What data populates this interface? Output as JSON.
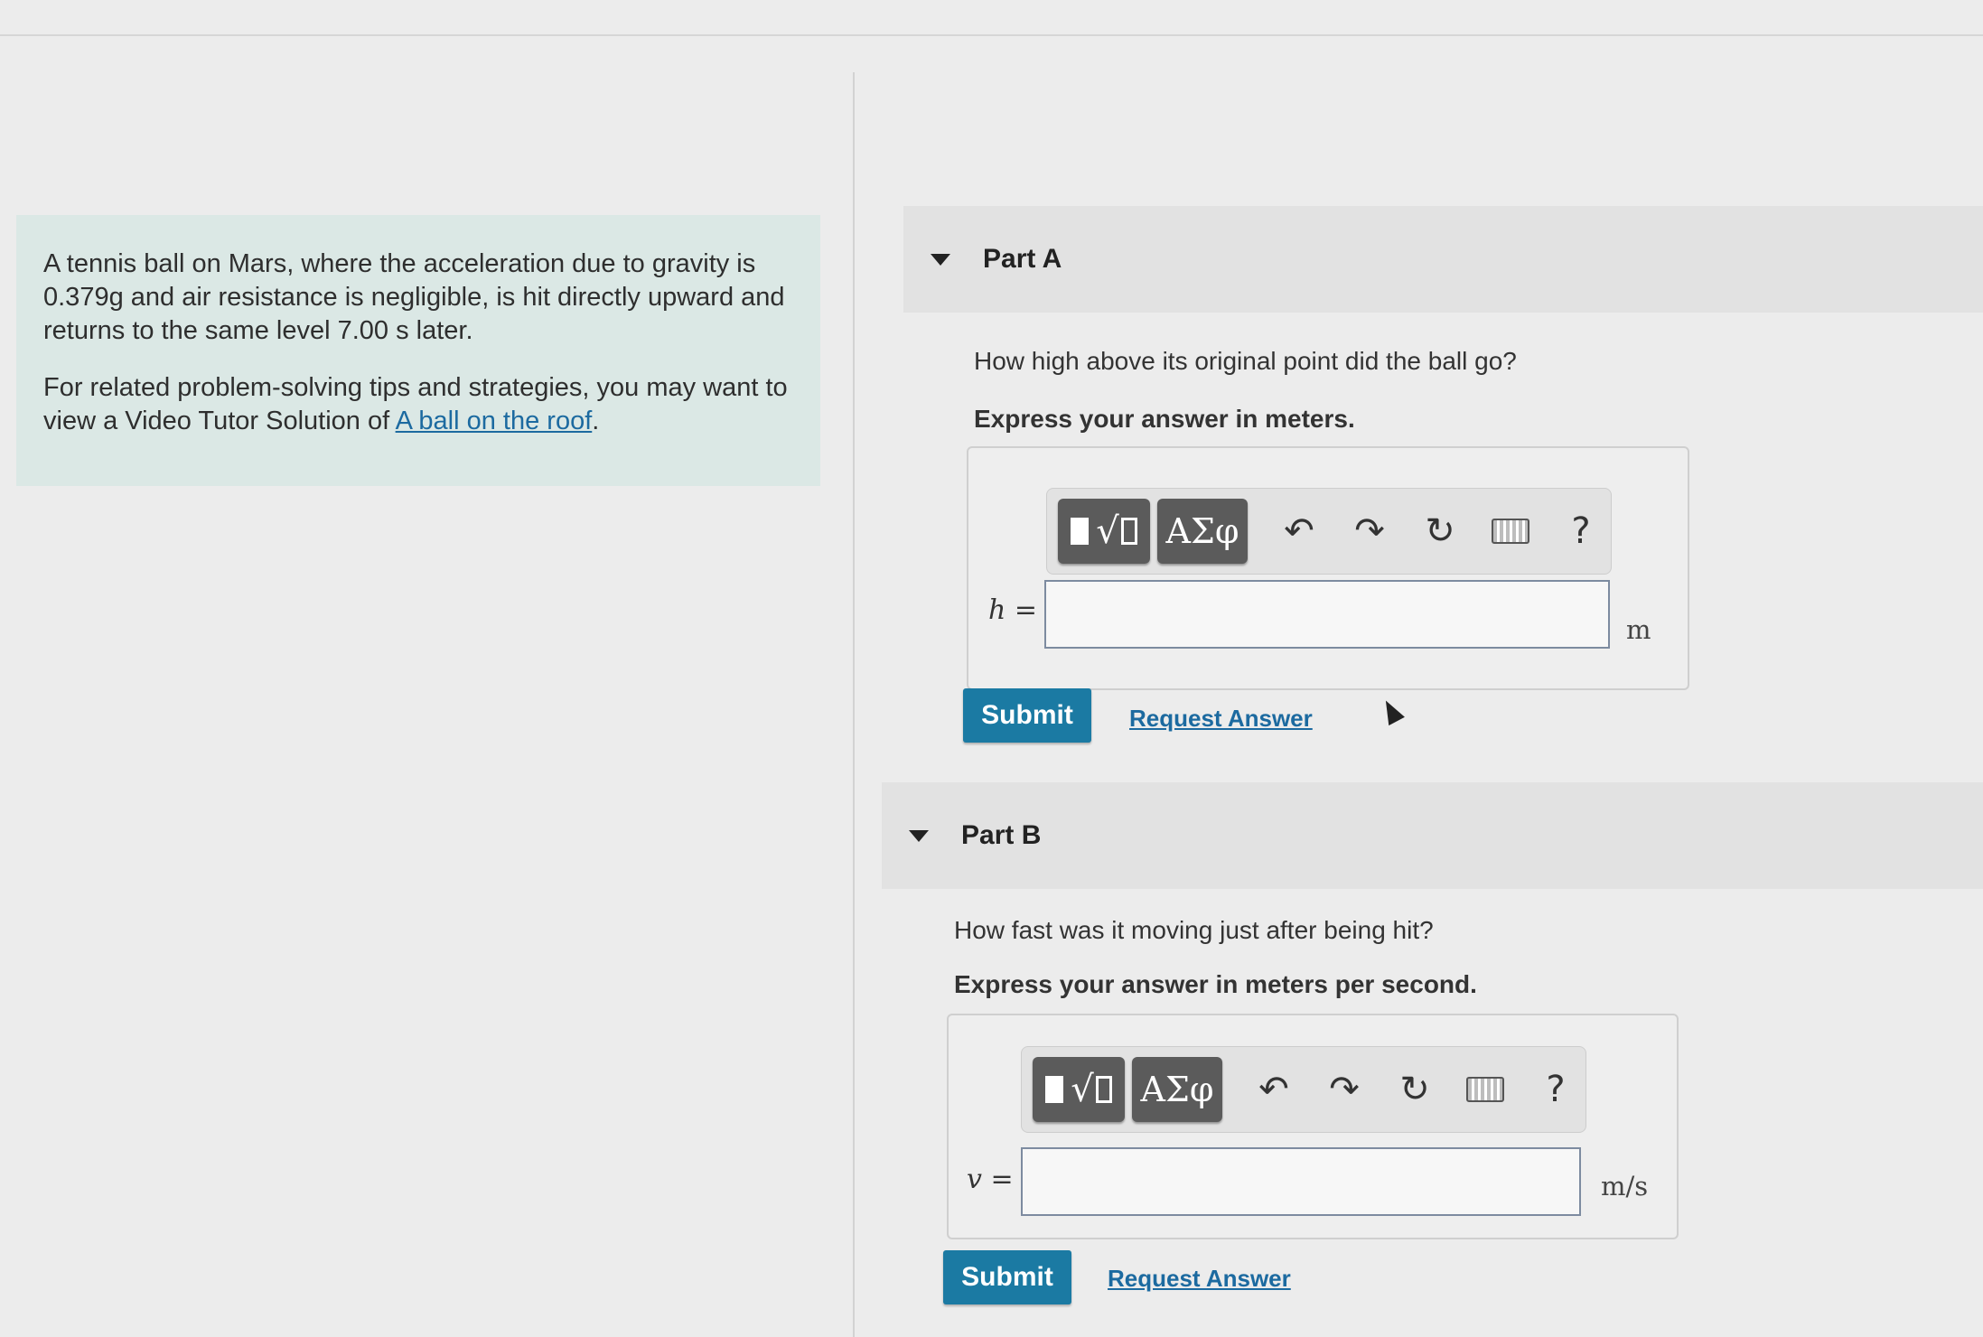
{
  "problem": {
    "text_1": "A tennis ball on Mars, where the acceleration due to gravity is 0.379g and air resistance is negligible, is hit directly upward and returns to the same level 7.00 s later.",
    "text_2": "For related problem-solving tips and strategies, you may want to view a Video Tutor Solution of ",
    "link": "A ball on the roof",
    "text_3": "."
  },
  "toolbar": {
    "greek": "ΑΣφ",
    "sqrt_glyph": "√",
    "undo_glyph": "↶",
    "redo_glyph": "↷",
    "reset_glyph": "↻",
    "help": "?"
  },
  "parts": [
    {
      "title": "Part A",
      "question": "How high above its original point did the ball go?",
      "instruction": "Express your answer in meters.",
      "variable": "h =",
      "value": "",
      "unit": "m",
      "submit_label": "Submit",
      "request_label": "Request Answer"
    },
    {
      "title": "Part B",
      "question": "How fast was it moving just after being hit?",
      "instruction": "Express your answer in meters per second.",
      "variable": "v =",
      "value": "",
      "unit": "m/s",
      "submit_label": "Submit",
      "request_label": "Request Answer"
    }
  ]
}
